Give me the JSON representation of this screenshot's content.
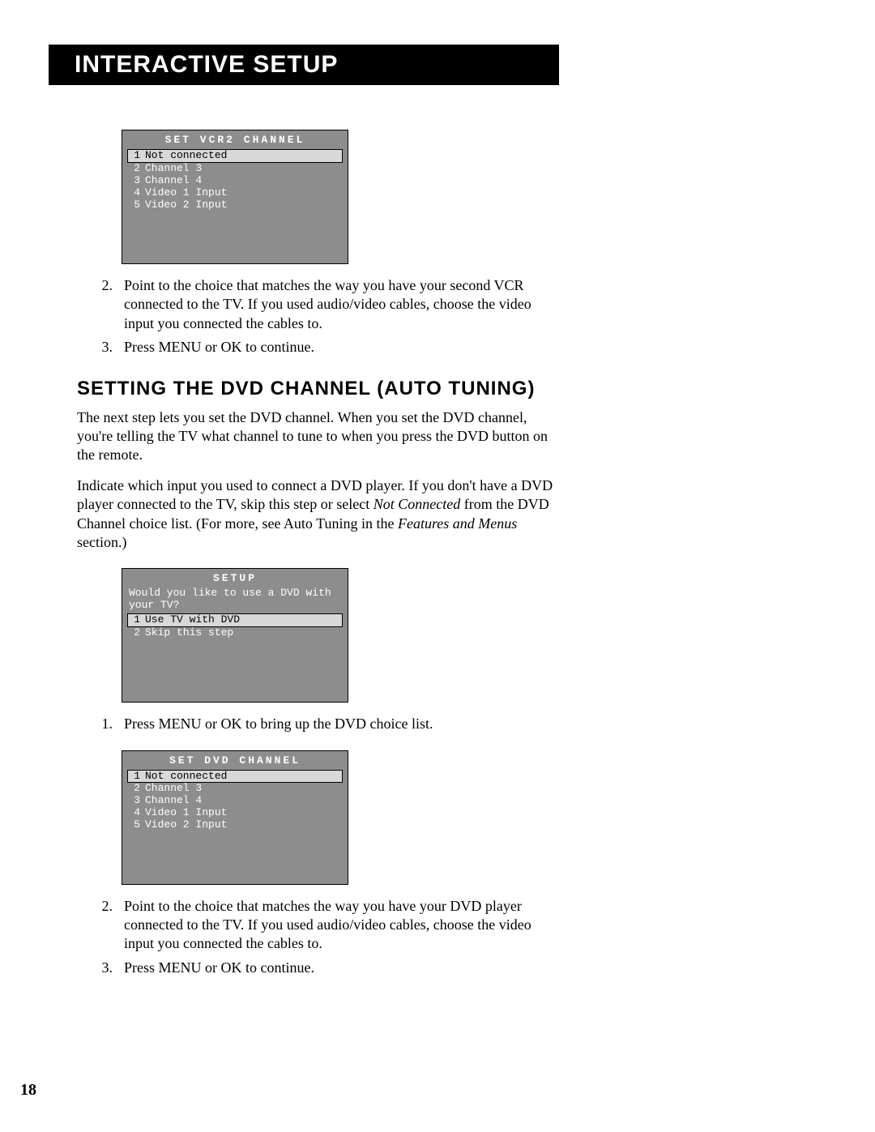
{
  "header": {
    "title": "Interactive Setup"
  },
  "osd1": {
    "title": "SET VCR2 CHANNEL",
    "items": [
      {
        "num": "1",
        "label": "Not connected",
        "selected": true
      },
      {
        "num": "2",
        "label": "Channel 3",
        "selected": false
      },
      {
        "num": "3",
        "label": "Channel 4",
        "selected": false
      },
      {
        "num": "4",
        "label": "Video 1 Input",
        "selected": false
      },
      {
        "num": "5",
        "label": "Video 2 Input",
        "selected": false
      }
    ]
  },
  "steps1": {
    "s2": {
      "n": "2.",
      "t": "Point to the choice that matches the way you have your second VCR connected to the TV. If you used audio/video cables, choose the video input you connected the cables to."
    },
    "s3": {
      "n": "3.",
      "t": "Press MENU or OK to continue."
    }
  },
  "section": {
    "title": "Setting the DVD Channel (Auto Tuning)"
  },
  "para1": "The next step lets you set the DVD channel. When you set the DVD channel, you're telling the TV what channel to tune to when you press the DVD button on the remote.",
  "para2": {
    "pre": "Indicate which input you used to connect a DVD player. If you don't have a DVD player connected to the TV, skip this step or select ",
    "em1": "Not Connected",
    "mid": " from the DVD Channel choice list. (For more, see Auto Tuning in the ",
    "em2": "Features and Menus",
    "post": " section.)"
  },
  "osd2": {
    "title": "SETUP",
    "prompt": "Would you like to use a DVD with your TV?",
    "items": [
      {
        "num": "1",
        "label": "Use TV with DVD",
        "selected": true
      },
      {
        "num": "2",
        "label": "Skip this step",
        "selected": false
      }
    ]
  },
  "steps2": {
    "s1": {
      "n": "1.",
      "t": "Press MENU or OK to bring up the DVD choice list."
    }
  },
  "osd3": {
    "title": "SET DVD CHANNEL",
    "items": [
      {
        "num": "1",
        "label": "Not connected",
        "selected": true
      },
      {
        "num": "2",
        "label": "Channel 3",
        "selected": false
      },
      {
        "num": "3",
        "label": "Channel 4",
        "selected": false
      },
      {
        "num": "4",
        "label": "Video 1 Input",
        "selected": false
      },
      {
        "num": "5",
        "label": "Video 2 Input",
        "selected": false
      }
    ]
  },
  "steps3": {
    "s2": {
      "n": "2.",
      "t": "Point to the choice that matches the way you have your DVD player connected to the TV. If you used audio/video cables, choose the video input you connected the cables to."
    },
    "s3": {
      "n": "3.",
      "t": "Press MENU or OK to continue."
    }
  },
  "pageNumber": "18"
}
